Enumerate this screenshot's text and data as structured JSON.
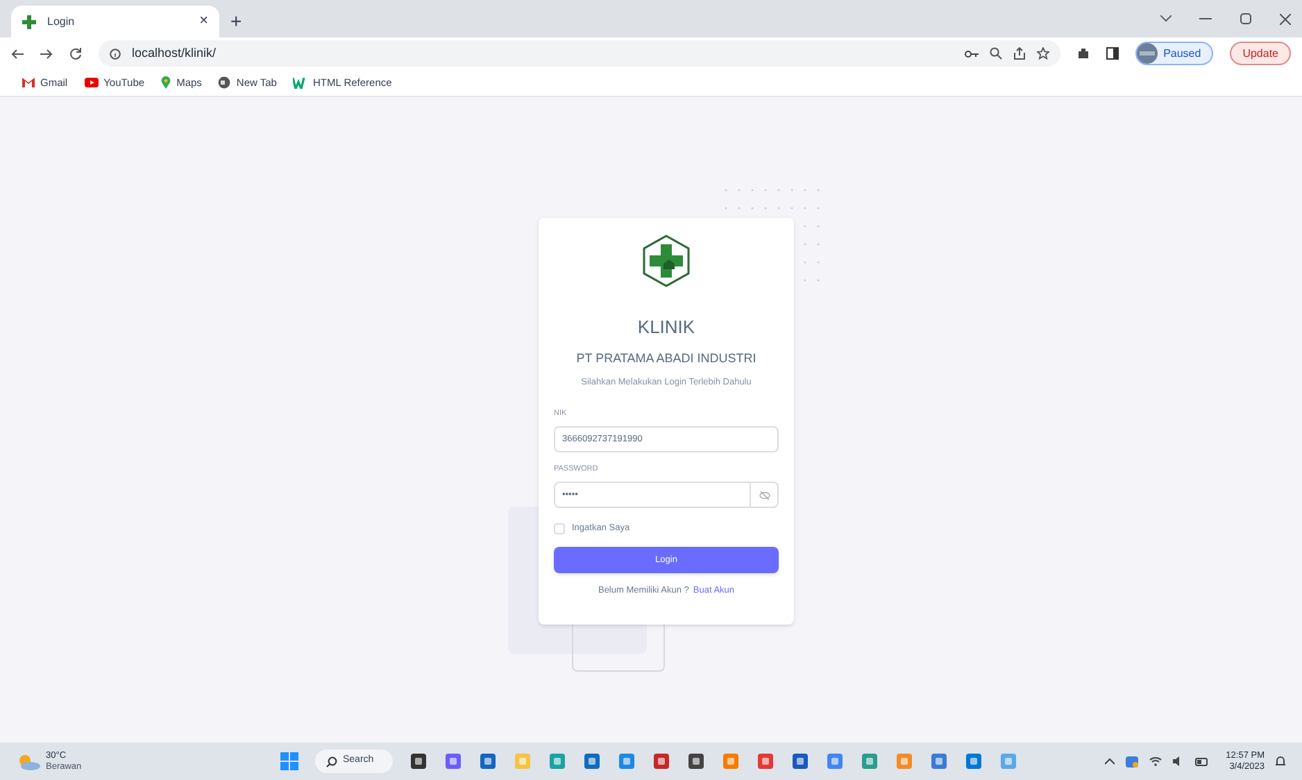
{
  "browser": {
    "tab": {
      "title": "Login",
      "close": "×"
    },
    "new_tab": "+",
    "url": "localhost/klinik/",
    "bookmarks": [
      {
        "label": "Gmail"
      },
      {
        "label": "YouTube"
      },
      {
        "label": "Maps"
      },
      {
        "label": "New Tab"
      },
      {
        "label": "HTML Reference"
      }
    ],
    "profile": "Paused",
    "update": "Update"
  },
  "login": {
    "title": "KLINIK",
    "company": "PT PRATAMA ABADI INDUSTRI",
    "subtitle": "Silahkan Melakukan Login Terlebih Dahulu",
    "nik": {
      "label": "NIK",
      "value": "3666092737191990"
    },
    "password": {
      "label": "PASSWORD",
      "value": "•••••"
    },
    "remember": {
      "label": "Ingatkan Saya",
      "checked": false
    },
    "button": "Login",
    "signup_prompt": "Belum Memiliki Akun ?",
    "signup_link": "Buat Akun"
  },
  "taskbar": {
    "temperature": "30°C",
    "weather": "Berawan",
    "search": "Search",
    "time": "12:57 PM",
    "date": "3/4/2023"
  }
}
